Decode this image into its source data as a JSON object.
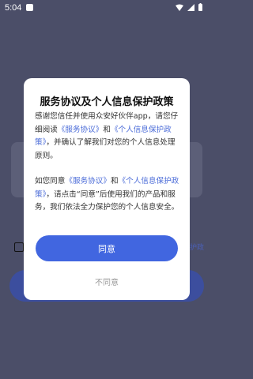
{
  "status_bar": {
    "time": "5:04"
  },
  "dialog": {
    "title": "服务协议及个人信息保护政策",
    "p1_text1": "感谢您信任并使用众安好伙伴app，请您仔细阅读",
    "p1_link1": "《服务协议》",
    "p1_text2": "和",
    "p1_link2": "《个人信息保护政策》",
    "p1_text3": "，并确认了解我们对您的个人信息处理原则。",
    "p2_text1": "如您同意",
    "p2_link1": "《服务协议》",
    "p2_text2": "和",
    "p2_link2": "《个人信息保护政策》",
    "p2_text3": "，请点击“同意”后使用我们的产品和服务，我们依法全力保护您的个人信息安全。",
    "agree_label": "同意",
    "disagree_label": "不同意"
  },
  "background": {
    "agreement_link_partial": "护政"
  },
  "colors": {
    "accent": "#4166e0",
    "link": "#4a6bd8",
    "overlay": "#4b4e68"
  }
}
